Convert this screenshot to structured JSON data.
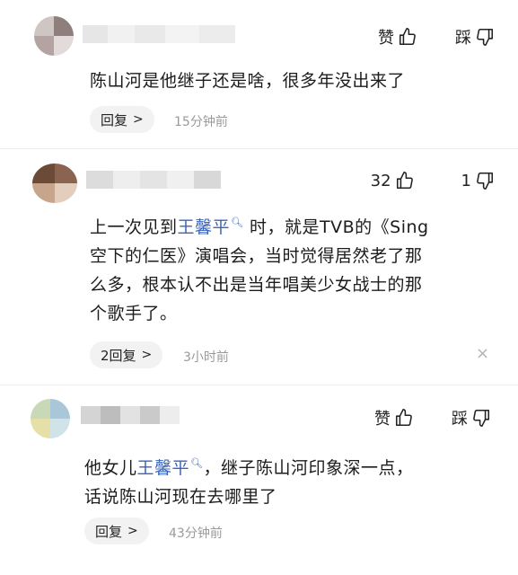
{
  "comments": [
    {
      "like_label": "赞",
      "dislike_label": "踩",
      "text": "陈山河是他继子还是啥，很多年没出来了",
      "reply_label": "回复",
      "reply_chevron": ">",
      "time": "15分钟前"
    },
    {
      "like_count": "32",
      "dislike_count": "1",
      "text_before_mention": "上一次见到",
      "mention": "王馨平",
      "mention_icon": "search-icon",
      "line1_after_mention": " 时，就是TVB的《Sing",
      "line2": "空下的仁医》演唱会，当时觉得居然老了那",
      "line3": "么多，根本认不出是当年唱美少女战士的那",
      "line4": "个歌手了。",
      "reply_label": "2回复",
      "reply_chevron": ">",
      "time": "3小时前",
      "close": "×"
    },
    {
      "like_label": "赞",
      "dislike_label": "踩",
      "text_before_mention": "他女儿",
      "mention": "王馨平",
      "mention_icon": "search-icon",
      "line1_after_mention": "，继子陈山河印象深一点，",
      "line2": "话说陈山河现在去哪里了",
      "reply_label": "回复",
      "reply_chevron": ">",
      "time": "43分钟前"
    }
  ],
  "colors": {
    "mention": "#3a64b8",
    "time": "#9a9a9a",
    "pill_bg": "#f2f2f2"
  }
}
